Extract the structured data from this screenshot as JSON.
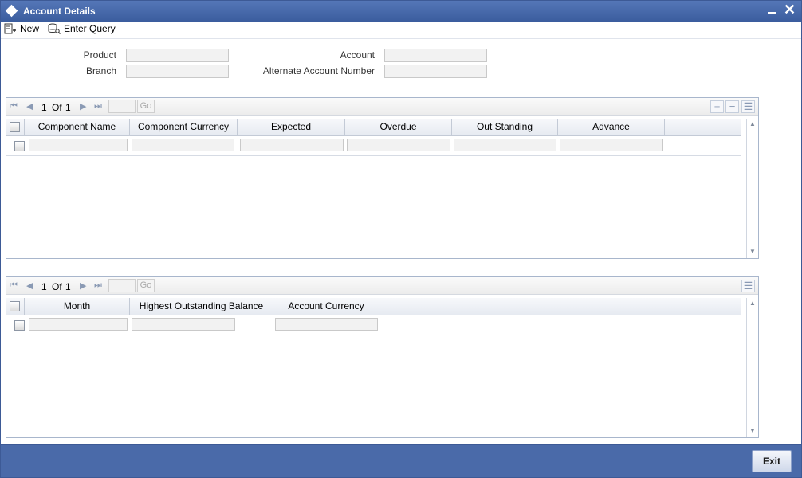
{
  "window": {
    "title": "Account Details"
  },
  "toolbar": {
    "new_label": "New",
    "enter_query_label": "Enter Query"
  },
  "form": {
    "product_label": "Product",
    "branch_label": "Branch",
    "account_label": "Account",
    "alt_account_label": "Alternate Account Number",
    "product_value": "",
    "branch_value": "",
    "account_value": "",
    "alt_account_value": ""
  },
  "grid1": {
    "pager": {
      "current": "1",
      "of_label": "Of",
      "total": "1",
      "go_label": "Go"
    },
    "columns": [
      "Component Name",
      "Component Currency",
      "Expected",
      "Overdue",
      "Out Standing",
      "Advance"
    ]
  },
  "grid2": {
    "pager": {
      "current": "1",
      "of_label": "Of",
      "total": "1",
      "go_label": "Go"
    },
    "columns": [
      "Month",
      "Highest Outstanding Balance",
      "Account Currency"
    ]
  },
  "footer": {
    "exit_label": "Exit"
  }
}
